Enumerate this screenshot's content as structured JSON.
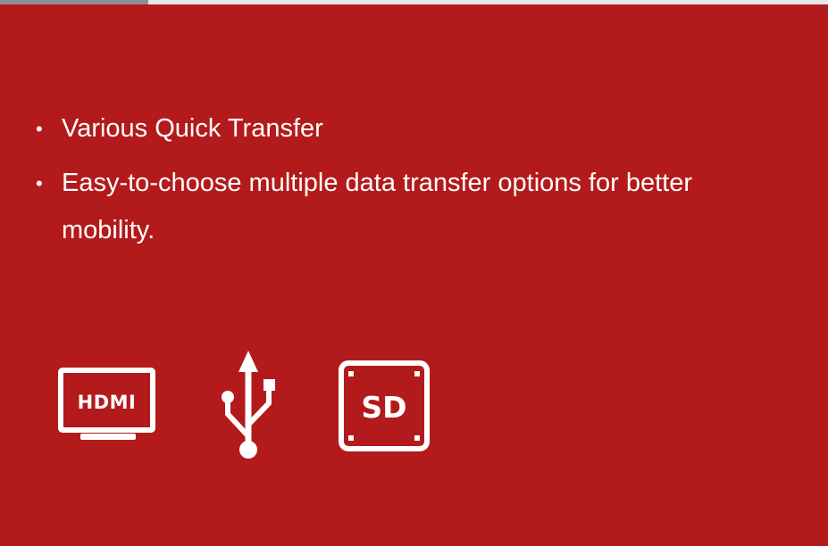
{
  "features": [
    {
      "bullet": "•",
      "text": "Various Quick Transfer"
    },
    {
      "bullet": "•",
      "text": "Easy-to-choose multiple data transfer options for better mobility."
    }
  ],
  "icons": [
    {
      "name": "hdmi-icon",
      "label": "HDMI"
    },
    {
      "name": "usb-icon",
      "label": ""
    },
    {
      "name": "sd-card-icon",
      "label": "SD"
    }
  ],
  "colors": {
    "background": "#b31a1b",
    "foreground": "#ffffff"
  }
}
